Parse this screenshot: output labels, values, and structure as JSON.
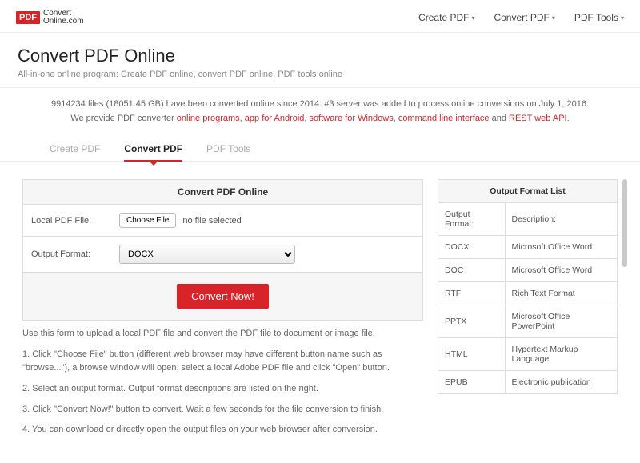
{
  "logo": {
    "badge": "PDF",
    "line1": "Convert",
    "line2": "Online.com"
  },
  "topnav": {
    "create": "Create PDF",
    "convert": "Convert PDF",
    "tools": "PDF Tools"
  },
  "hero": {
    "title": "Convert PDF Online",
    "subtitle": "All-in-one online program: Create PDF online, convert PDF online, PDF tools online"
  },
  "info": {
    "pre": "9914234 files (18051.45 GB) have been converted online since 2014. #3 server was added to process online conversions on July 1, 2016.",
    "provide": "We provide PDF converter ",
    "l1": "online programs",
    "s1": ", ",
    "l2": "app for Android",
    "s2": ", ",
    "l3": "software for Windows",
    "s3": ", ",
    "l4": "command line interface",
    "s4": " and ",
    "l5": "REST web API",
    "end": "."
  },
  "tabs": {
    "create": "Create PDF",
    "convert": "Convert PDF",
    "tools": "PDF Tools"
  },
  "form": {
    "head": "Convert PDF Online",
    "fileLabel": "Local PDF File:",
    "chooseFile": "Choose File",
    "fileStatus": "no file selected",
    "formatLabel": "Output Format:",
    "formatValue": "DOCX",
    "submit": "Convert Now!"
  },
  "instr": {
    "intro": "Use this form to upload a local PDF file and convert the PDF file to document or image file.",
    "s1": "1. Click \"Choose File\" button (different web browser may have different button name such as \"browse...\"), a browse window will open, select a local Adobe PDF file and click \"Open\" button.",
    "s2": "2. Select an output format. Output format descriptions are listed on the right.",
    "s3": "3. Click \"Convert Now!\" button to convert. Wait a few seconds for the file conversion to finish.",
    "s4": "4. You can download or directly open the output files on your web browser after conversion."
  },
  "fmt": {
    "head": "Output Format List",
    "h1": "Output Format:",
    "h2": "Description:",
    "rows": [
      {
        "a": "DOCX",
        "b": "Microsoft Office Word"
      },
      {
        "a": "DOC",
        "b": "Microsoft Office Word"
      },
      {
        "a": "RTF",
        "b": "Rich Text Format"
      },
      {
        "a": "PPTX",
        "b": "Microsoft Office PowerPoint"
      },
      {
        "a": "HTML",
        "b": "Hypertext Markup Language"
      },
      {
        "a": "EPUB",
        "b": "Electronic publication"
      }
    ]
  }
}
